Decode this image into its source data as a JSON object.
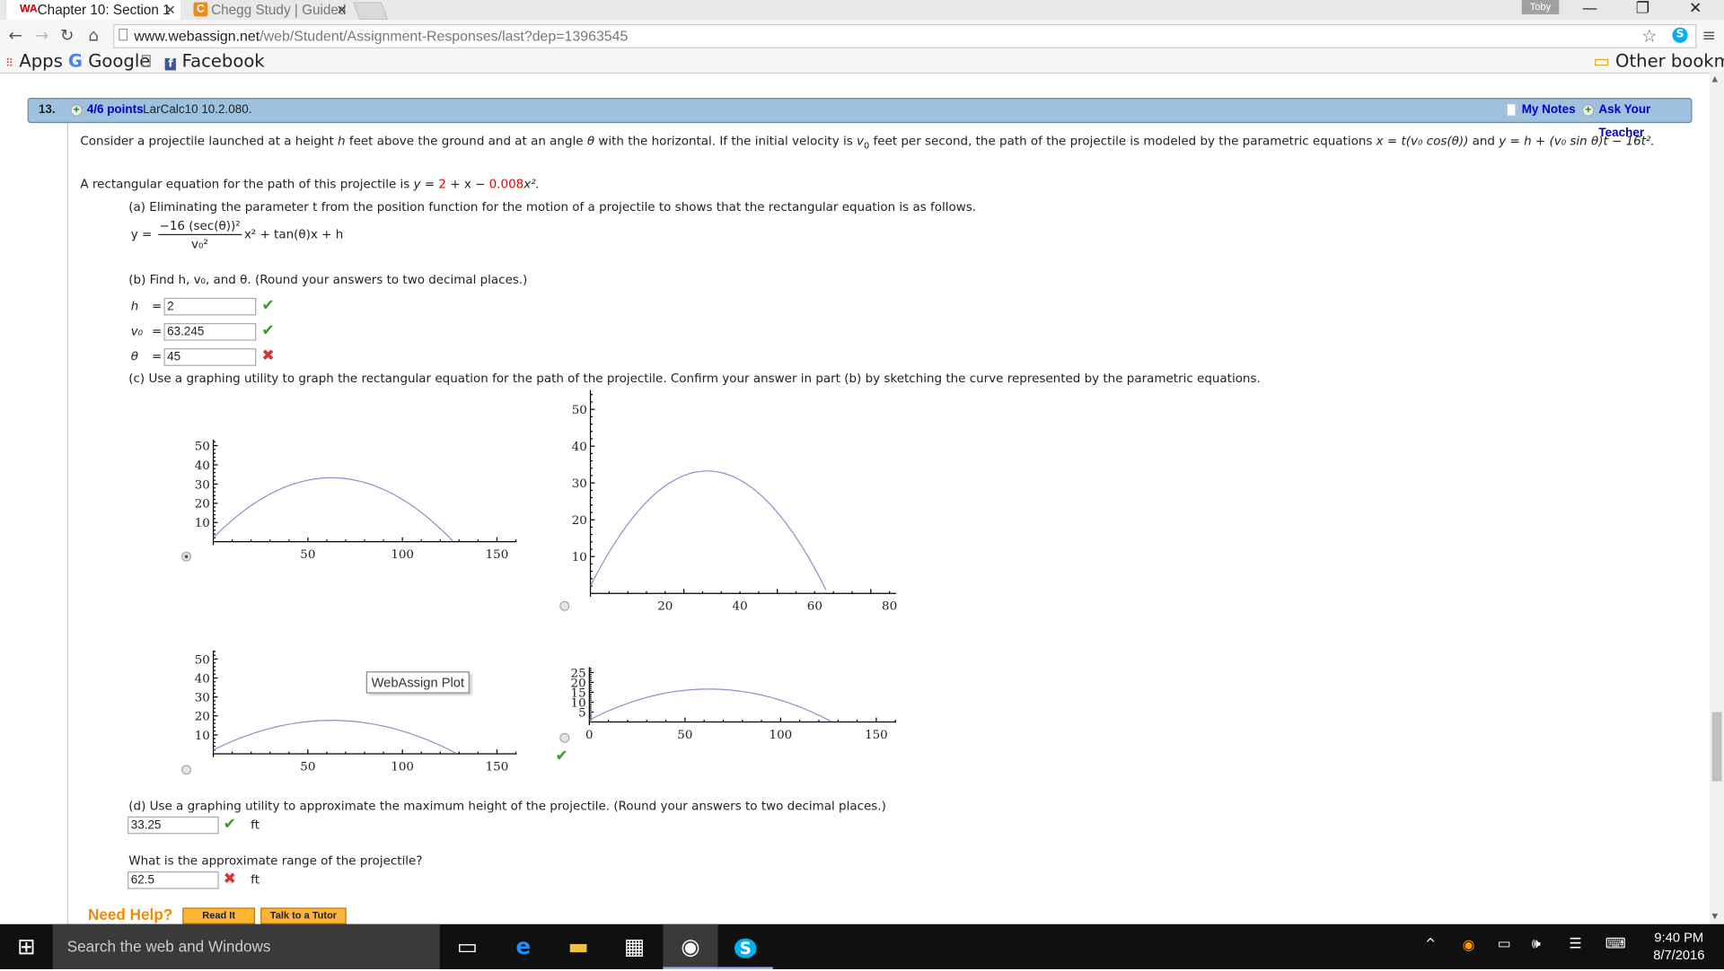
{
  "browser": {
    "tabs": [
      {
        "title": "Chapter 10: Section 1",
        "favicon": "webassign-icon",
        "active": true
      },
      {
        "title": "Chegg Study | Guided",
        "favicon": "chegg-icon",
        "active": false
      }
    ],
    "user_badge": "Toby",
    "url_host": "www.webassign.net",
    "url_path": "/web/Student/Assignment-Responses/last?dep=13963545",
    "bookmarks": [
      "Apps",
      "Google",
      "Facebook"
    ],
    "other_bookmarks": "Other bookmarks"
  },
  "question": {
    "number": "13.",
    "points": "4/6 points",
    "source": "LarCalc10 10.2.080.",
    "my_notes": "My Notes",
    "ask_teacher": "Ask Your Teacher",
    "intro_1": "Consider a projectile launched at a height ",
    "intro_2": " feet above the ground and at an angle ",
    "intro_3": " with the horizontal. If the initial velocity is ",
    "intro_4": " feet per second, the path of the projectile is modeled by the parametric equations ",
    "intro_eq1": "x = t(v₀ cos(θ))",
    "intro_and": " and ",
    "intro_eq2": "y = h + (v₀ sin θ)t − 16t².",
    "rect_1": "A rectangular equation for the path of this projectile is ",
    "rect_y": "y = ",
    "rect_h": "2",
    "rect_mid": " + x − ",
    "rect_coef": "0.008",
    "rect_end": "x².",
    "part_a": "(a) Eliminating the parameter t from the position function for the motion of a projectile to shows that the rectangular equation is as follows.",
    "formula_lhs": "y =",
    "formula_num": "−16 (sec(θ))²",
    "formula_den": "v₀²",
    "formula_rest": "x² + tan(θ)x + h",
    "part_b": "(b) Find h, v₀, and θ. (Round your answers to two decimal places.)",
    "answers_b": [
      {
        "label": "h",
        "value": "2",
        "status": "correct"
      },
      {
        "label": "v₀",
        "value": "63.245",
        "status": "correct"
      },
      {
        "label": "θ",
        "value": "45",
        "status": "incorrect"
      }
    ],
    "part_c": "(c) Use a graphing utility to graph the rectangular equation for the path of the projectile. Confirm your answer in part (b) by sketching the curve represented by the parametric equations.",
    "plot_tooltip": "WebAssign Plot",
    "part_d": "(d) Use a graphing utility to approximate the maximum height of the projectile. (Round your answers to two decimal places.)",
    "max_height": {
      "value": "33.25",
      "unit": "ft",
      "status": "correct"
    },
    "range_q": "What is the approximate range of the projectile?",
    "range": {
      "value": "62.5",
      "unit": "ft",
      "status": "incorrect"
    },
    "need_help": "Need Help?",
    "read_it": "Read It",
    "talk_tutor": "Talk to a Tutor"
  },
  "chart_data": [
    {
      "type": "line",
      "selected": true,
      "equation": {
        "c": 2,
        "b": 1,
        "a": -0.008
      },
      "xlim": [
        0,
        160
      ],
      "ylim": [
        0,
        55
      ],
      "xticks": [
        "50",
        "100",
        "150"
      ],
      "yticks": [
        "10",
        "20",
        "30",
        "40",
        "50"
      ]
    },
    {
      "type": "line",
      "selected": false,
      "equation": {
        "c": 2,
        "b": 2,
        "a": -0.032
      },
      "xlim": [
        0,
        82
      ],
      "ylim": [
        0,
        55
      ],
      "xticks": [
        "20",
        "40",
        "60",
        "80"
      ],
      "yticks": [
        "10",
        "20",
        "30",
        "40",
        "50"
      ]
    },
    {
      "type": "line",
      "selected": false,
      "equation": {
        "c": 2,
        "b": 0.5,
        "a": -0.004
      },
      "xlim": [
        0,
        160
      ],
      "ylim": [
        0,
        55
      ],
      "xticks": [
        "50",
        "100",
        "150"
      ],
      "yticks": [
        "10",
        "20",
        "30",
        "40",
        "50"
      ]
    },
    {
      "type": "line",
      "selected": false,
      "marked_correct": true,
      "equation": {
        "c": 1,
        "b": 0.5,
        "a": -0.004
      },
      "xlim": [
        0,
        162
      ],
      "ylim": [
        0,
        28
      ],
      "xticks": [
        "0",
        "50",
        "100",
        "150"
      ],
      "yticks": [
        "5",
        "10",
        "15",
        "20",
        "25"
      ]
    }
  ],
  "colors": {
    "header_bar": "#9dc1df",
    "curve": "#8f8fd0",
    "correct": "#3a9c2a",
    "incorrect": "#e03030",
    "help": "#f08a00",
    "red_value": "#ee0000"
  },
  "taskbar": {
    "search_placeholder": "Search the web and Windows",
    "time": "9:40 PM",
    "date": "8/7/2016"
  }
}
